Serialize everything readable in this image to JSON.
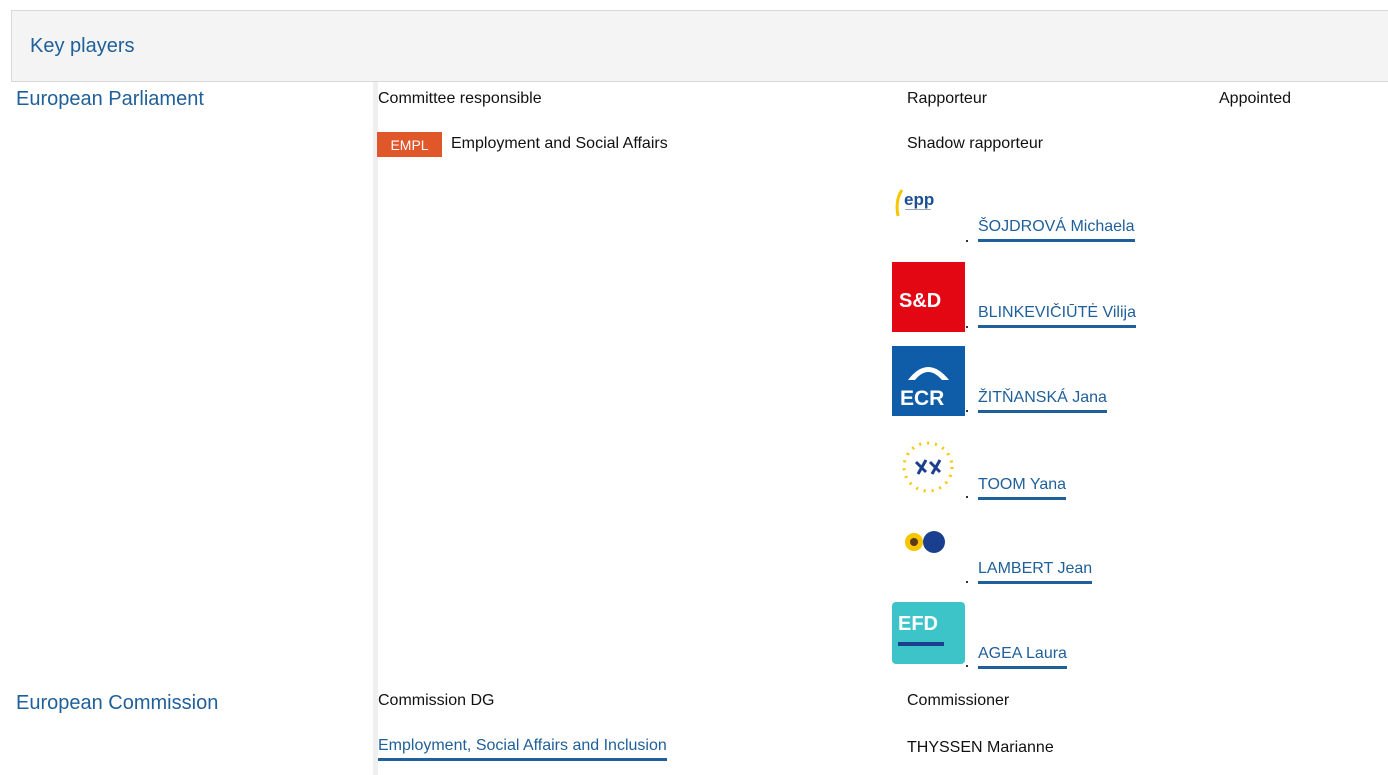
{
  "section": {
    "title": "Key players"
  },
  "parliament": {
    "institution": "European Parliament",
    "committee_header": "Committee responsible",
    "rapporteur_header": "Rapporteur",
    "appointed_header": "Appointed",
    "shadow_header": "Shadow rapporteur",
    "committee": {
      "badge": "EMPL",
      "name": "Employment and Social Affairs",
      "badge_color": "#e0572a"
    },
    "shadows": [
      {
        "name": "ŠOJDROVÁ Michaela",
        "group_icon": "epp-logo-icon"
      },
      {
        "name": "BLINKEVIČIŪTĖ Vilija",
        "group_icon": "s-and-d-logo-icon"
      },
      {
        "name": "ŽITŇANSKÁ Jana",
        "group_icon": "ecr-logo-icon"
      },
      {
        "name": "TOOM Yana",
        "group_icon": "alde-logo-icon"
      },
      {
        "name": "LAMBERT Jean",
        "group_icon": "greens-efa-logo-icon"
      },
      {
        "name": "AGEA Laura",
        "group_icon": "efdd-logo-icon"
      }
    ]
  },
  "commission": {
    "institution": "European Commission",
    "dg_header": "Commission DG",
    "commissioner_header": "Commissioner",
    "dg": "Employment, Social Affairs and Inclusion",
    "commissioner": "THYSSEN Marianne"
  },
  "colors": {
    "link": "#1f5f9a",
    "header_bg": "#f4f4f4",
    "sd_red": "#e30613",
    "ecr_blue": "#0f5ca8",
    "efdd_teal": "#3cc4c9"
  }
}
